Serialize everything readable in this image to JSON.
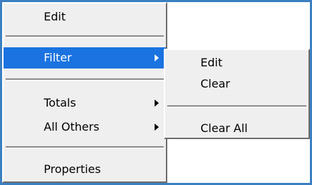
{
  "main_menu": {
    "items": [
      {
        "label": "Edit"
      },
      {
        "label": "Filter",
        "has_submenu": true,
        "selected": true
      },
      {
        "label": "Totals",
        "has_submenu": true
      },
      {
        "label": "All Others",
        "has_submenu": true
      },
      {
        "label": "Properties"
      }
    ]
  },
  "submenu": {
    "items": [
      {
        "label": "Edit"
      },
      {
        "label": "Clear"
      },
      {
        "label": "Clear All"
      }
    ]
  },
  "colors": {
    "frame_border": "#3c7fc1",
    "menu_background": "#efefef",
    "selection_background": "#1a73e0",
    "selection_text": "#ffffff"
  }
}
